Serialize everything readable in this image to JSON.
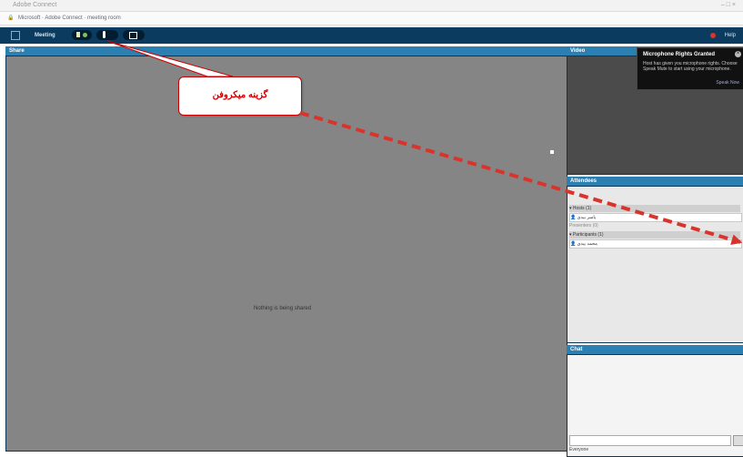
{
  "window": {
    "title": "Adobe Connect"
  },
  "address": {
    "url": "Microsoft · Adobe Connect · meeting room"
  },
  "menubar": {
    "meeting_label": "Meeting",
    "help_label": "Help"
  },
  "panels": {
    "share_title": "Share",
    "share_message": "Nothing is being shared",
    "video_title": "Video",
    "attendees_title": "Attendees",
    "chat_title": "Chat",
    "chat_to": "Everyone"
  },
  "attendees": {
    "host_group": "Hosts (1)",
    "host_name": "یاسر بیدی",
    "host_sub": "Presenters (0)",
    "participant_group": "Participants (1)",
    "participant_name": "محمد بیدی"
  },
  "toast": {
    "title": "Microphone Rights Granted",
    "body": "Host has given you microphone rights. Choose Speak Mute to start using your microphone.",
    "link": "Speak Now"
  },
  "annotation": {
    "text": "گزینه میکروفن"
  }
}
